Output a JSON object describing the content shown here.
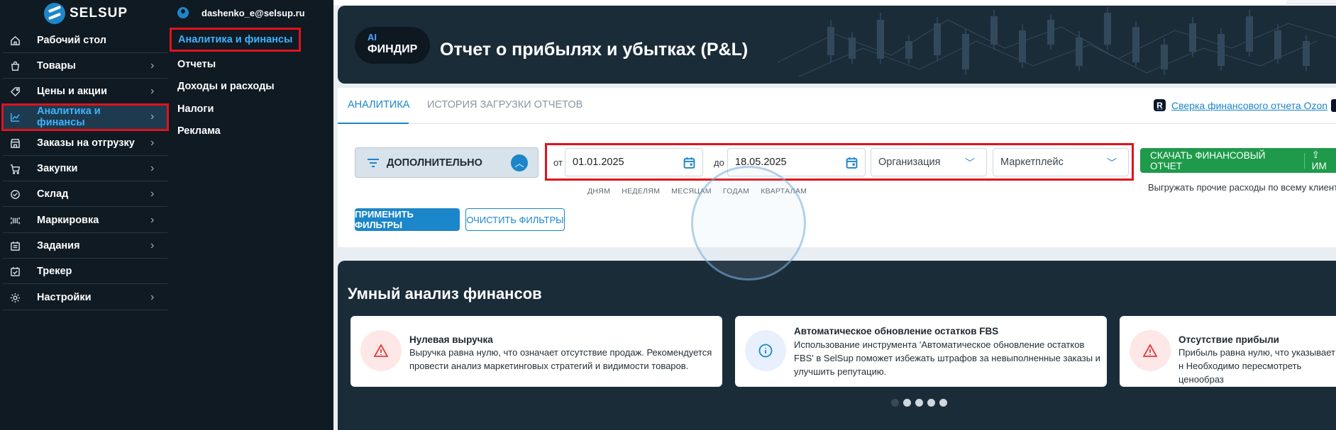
{
  "brand": {
    "logo_text": "SELSUP"
  },
  "sidebar": {
    "items": [
      {
        "label": "Рабочий стол",
        "icon": "home-icon",
        "has_chevron": false
      },
      {
        "label": "Товары",
        "icon": "bag-icon",
        "has_chevron": true
      },
      {
        "label": "Цены и акции",
        "icon": "tag-icon",
        "has_chevron": true
      },
      {
        "label": "Аналитика и финансы",
        "icon": "chart-icon",
        "has_chevron": true,
        "active": true
      },
      {
        "label": "Заказы на отгрузку",
        "icon": "store-icon",
        "has_chevron": true
      },
      {
        "label": "Закупки",
        "icon": "cart-icon",
        "has_chevron": true
      },
      {
        "label": "Склад",
        "icon": "check-circle-icon",
        "has_chevron": true
      },
      {
        "label": "Маркировка",
        "icon": "barcode-icon",
        "has_chevron": true
      },
      {
        "label": "Задания",
        "icon": "tasks-icon",
        "has_chevron": true
      },
      {
        "label": "Трекер",
        "icon": "tracker-icon",
        "has_chevron": false
      },
      {
        "label": "Настройки",
        "icon": "gear-icon",
        "has_chevron": true
      }
    ]
  },
  "subpanel": {
    "user_email": "dashenko_e@selsup.ru",
    "items": [
      {
        "label": "Аналитика и финансы",
        "active": true
      },
      {
        "label": "Отчеты"
      },
      {
        "label": "Доходы и расходы"
      },
      {
        "label": "Налоги"
      },
      {
        "label": "Реклама"
      }
    ]
  },
  "banner": {
    "badge_ai": "AI",
    "badge_label": "ФИНДИР",
    "title": "Отчет о прибылях и убытках (P&L)"
  },
  "tabs": [
    {
      "label": "АНАЛИТИКА",
      "active": true
    },
    {
      "label": "ИСТОРИЯ ЗАГРУЗКИ ОТЧЕТОВ"
    }
  ],
  "ozon_link": "Сверка финансового отчета Ozon",
  "filters": {
    "more_label": "ДОПОЛНИТЕЛЬНО",
    "from_label": "от",
    "to_label": "до",
    "date_from": "01.01.2025",
    "date_to": "18.05.2025",
    "organization_placeholder": "Организация",
    "marketplace_placeholder": "Маркетплейс",
    "periods": [
      "ДНЯМ",
      "НЕДЕЛЯМ",
      "МЕСЯЦАМ",
      "ГОДАМ",
      "КВАРТАЛАМ"
    ],
    "apply_label": "ПРИМЕНИТЬ ФИЛЬТРЫ",
    "clear_label": "ОЧИСТИТЬ ФИЛЬТРЫ"
  },
  "actions": {
    "download_label": "СКАЧАТЬ ФИНАНСОВЫЙ ОТЧЕТ",
    "import_label": "ИМ",
    "export_note": "Выгружать прочие расходы по всему клиенту"
  },
  "smart": {
    "title": "Умный анализ финансов",
    "cards": [
      {
        "icon": "warning-icon",
        "title": "Нулевая выручка",
        "text": "Выручка равна нулю, что означает отсутствие продаж. Рекомендуется провести анализ маркетинговых стратегий и видимости товаров."
      },
      {
        "icon": "info-icon",
        "title": "Автоматическое обновление остатков FBS",
        "text": "Использование инструмента 'Автоматическое обновление остатков FBS' в SelSup поможет избежать штрафов за невыполненные заказы и улучшить репутацию."
      },
      {
        "icon": "warning-icon",
        "title": "Отсутствие прибыли",
        "text": "Прибыль равна нулю, что указывает н Необходимо пересмотреть ценообраз"
      }
    ],
    "dots": 5,
    "active_dot": 0
  },
  "colors": {
    "sidebar_bg": "#0f1a22",
    "accent": "#1b86c9",
    "highlight_frame": "#e0121c",
    "download_button": "#1e9a4a",
    "banner_bg": "#1b2c39"
  }
}
